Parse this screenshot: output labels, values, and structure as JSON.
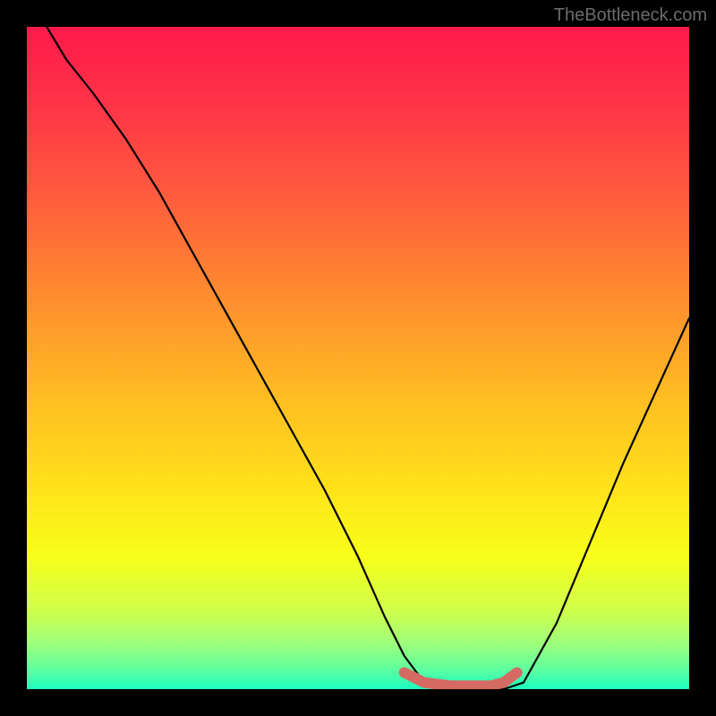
{
  "watermark": "TheBottleneck.com",
  "chart_data": {
    "type": "line",
    "title": "",
    "xlabel": "",
    "ylabel": "",
    "xlim": [
      0,
      100
    ],
    "ylim": [
      0,
      100
    ],
    "x": [
      0,
      3,
      6,
      10,
      15,
      20,
      25,
      30,
      35,
      40,
      45,
      50,
      54,
      57,
      60,
      64,
      72,
      75,
      80,
      85,
      90,
      95,
      100
    ],
    "values": [
      110,
      100,
      95,
      90,
      83,
      75,
      66,
      57,
      48,
      39,
      30,
      20,
      11,
      5,
      1,
      0,
      0,
      1,
      10,
      22,
      34,
      45,
      56
    ],
    "highlight_segment": {
      "x": [
        57,
        60,
        64,
        70,
        72,
        74
      ],
      "values": [
        2.5,
        1,
        0.5,
        0.5,
        1,
        2.5
      ],
      "color": "#d56a62"
    },
    "gradient_stops": [
      {
        "offset": 0.0,
        "color": "#ff1a4a"
      },
      {
        "offset": 0.1,
        "color": "#ff2f48"
      },
      {
        "offset": 0.25,
        "color": "#ff5a3e"
      },
      {
        "offset": 0.4,
        "color": "#ff8a30"
      },
      {
        "offset": 0.55,
        "color": "#ffba22"
      },
      {
        "offset": 0.7,
        "color": "#ffe31a"
      },
      {
        "offset": 0.8,
        "color": "#f7ff1a"
      },
      {
        "offset": 0.88,
        "color": "#d0ff4a"
      },
      {
        "offset": 0.93,
        "color": "#9fff7a"
      },
      {
        "offset": 0.97,
        "color": "#5effa0"
      },
      {
        "offset": 1.0,
        "color": "#1affc0"
      }
    ]
  }
}
